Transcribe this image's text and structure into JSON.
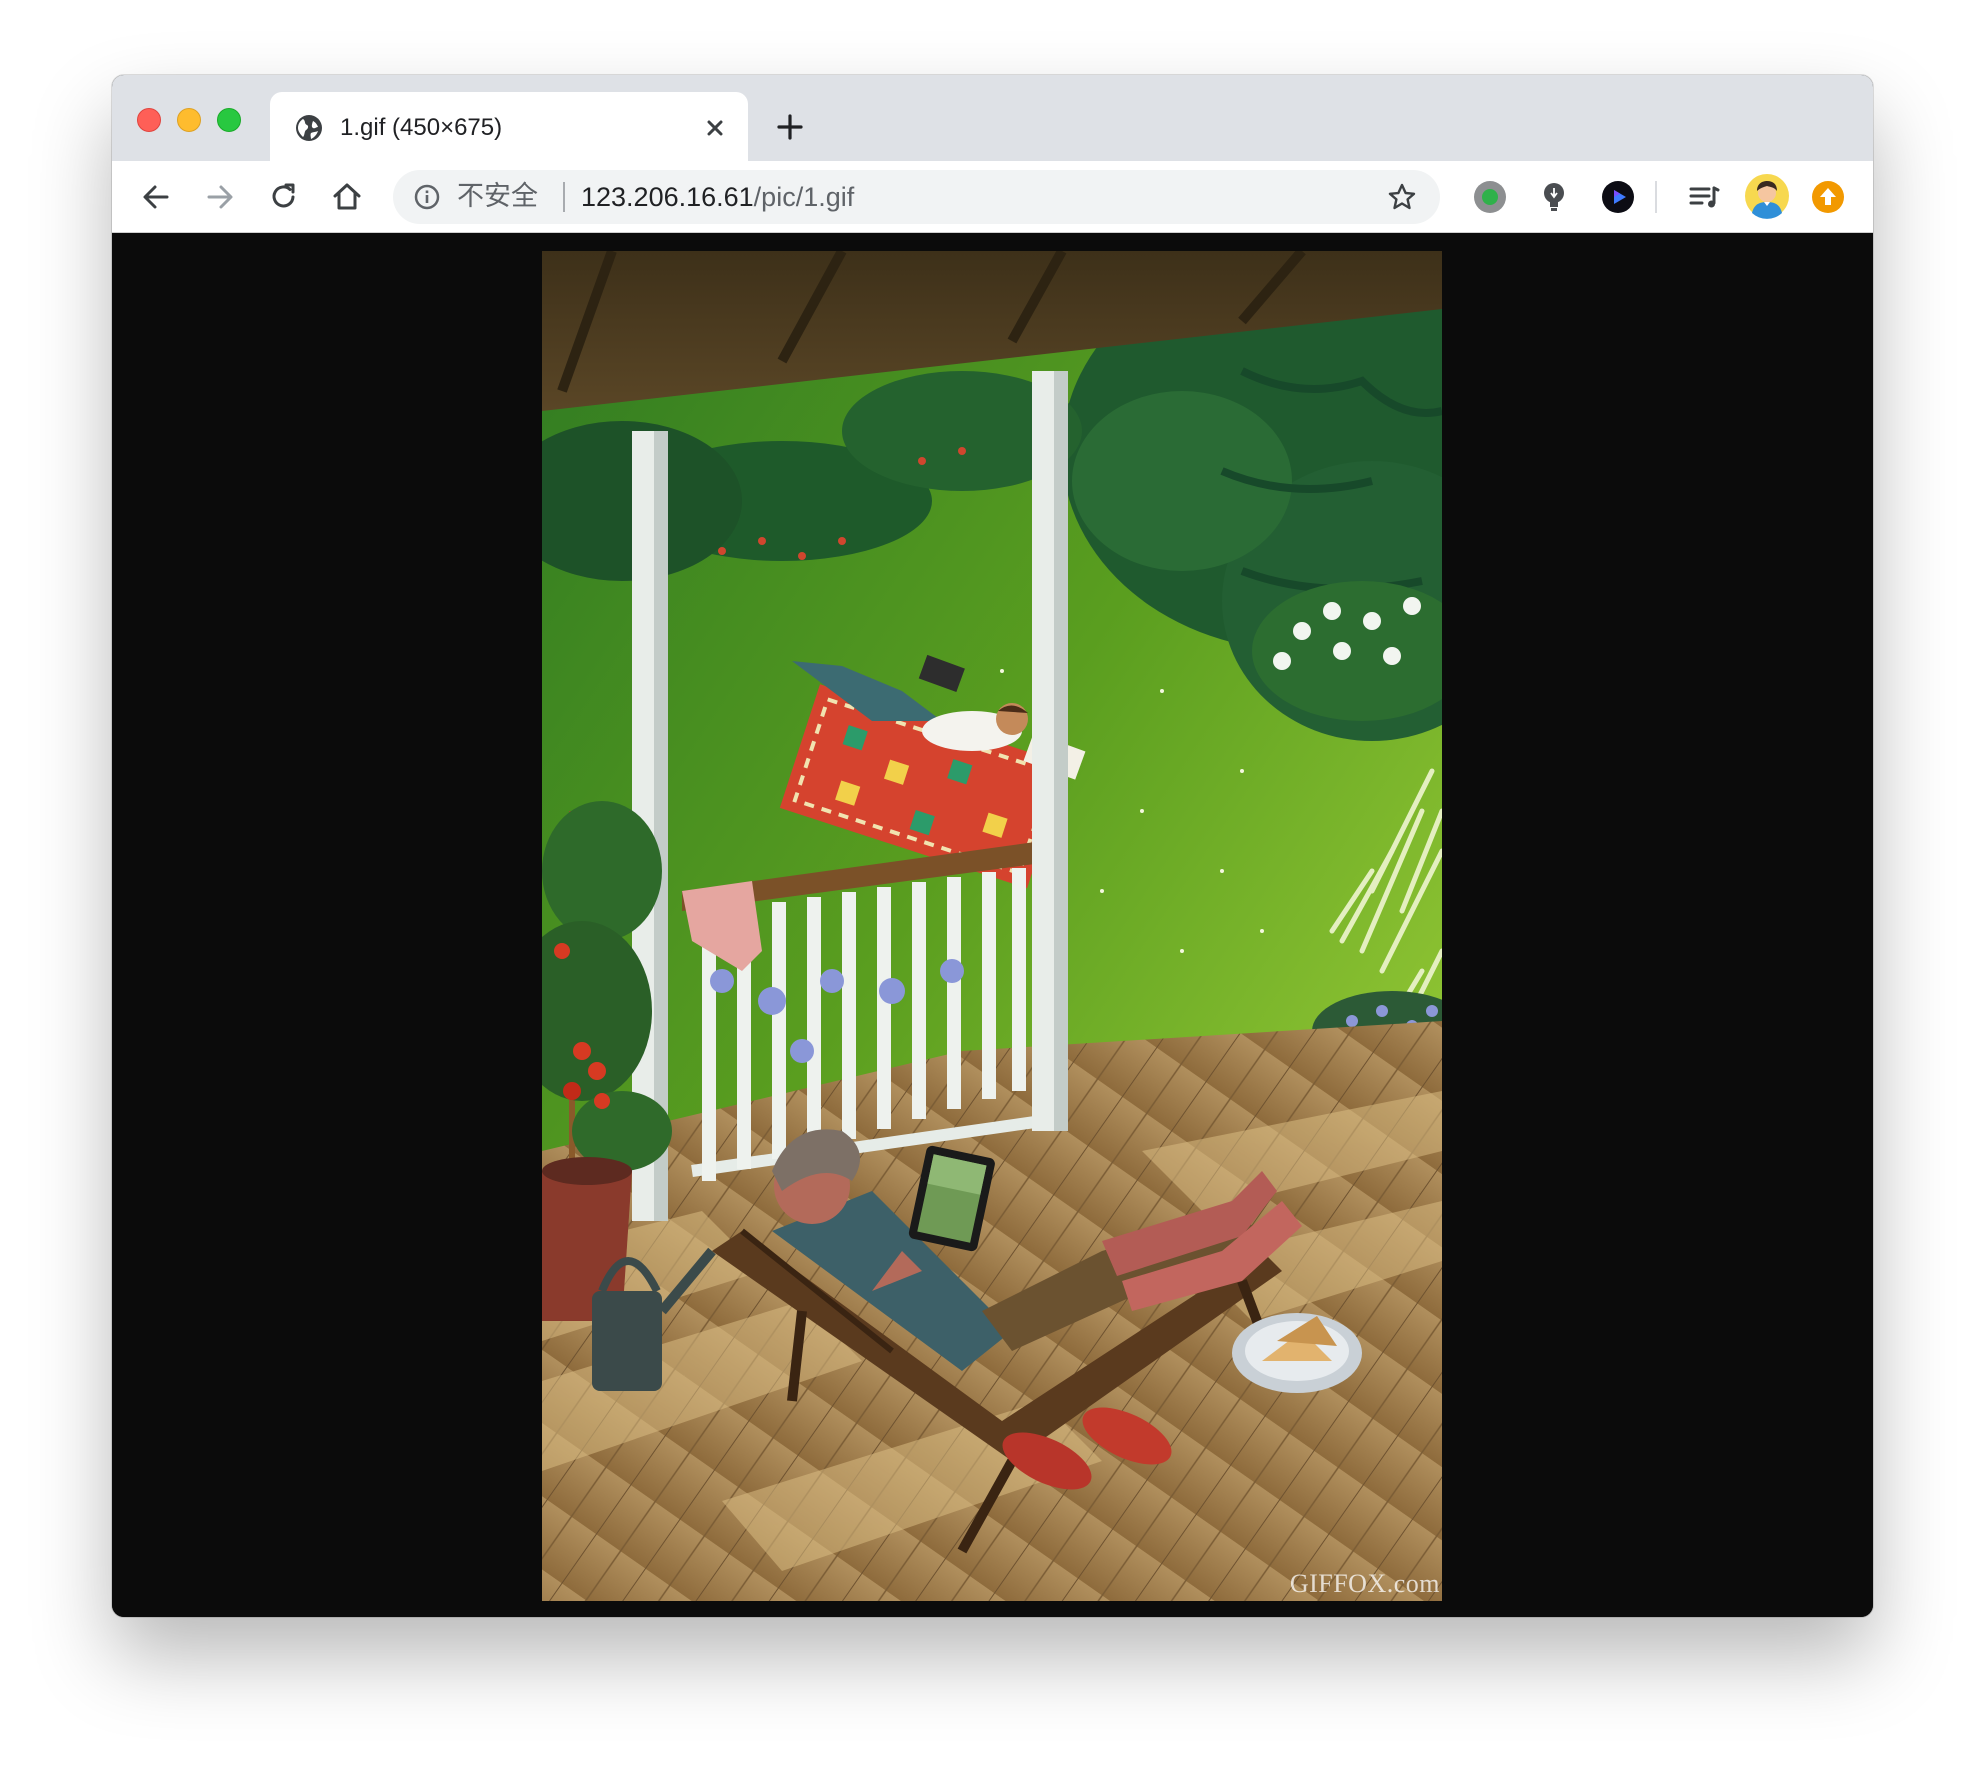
{
  "window": {
    "tab": {
      "title": "1.gif (450×675)"
    },
    "omnibox": {
      "security_text": "不安全",
      "url_host": "123.206.16.61",
      "url_path": "/pic/1.gif"
    },
    "icons": [
      "globe-icon",
      "close-icon",
      "plus-icon",
      "back-arrow-icon",
      "forward-arrow-icon",
      "reload-icon",
      "home-icon",
      "info-icon",
      "star-icon",
      "green-dot-extension-icon",
      "lightbulb-extension-icon",
      "play-extension-icon",
      "reading-list-icon",
      "profile-avatar-icon",
      "orange-upload-extension-icon"
    ]
  },
  "image": {
    "watermark": "GIFFOX.com"
  },
  "colors": {
    "titlebar": "#dee1e6",
    "content_bg": "#0b0b0b",
    "accent_orange": "#f29900"
  }
}
